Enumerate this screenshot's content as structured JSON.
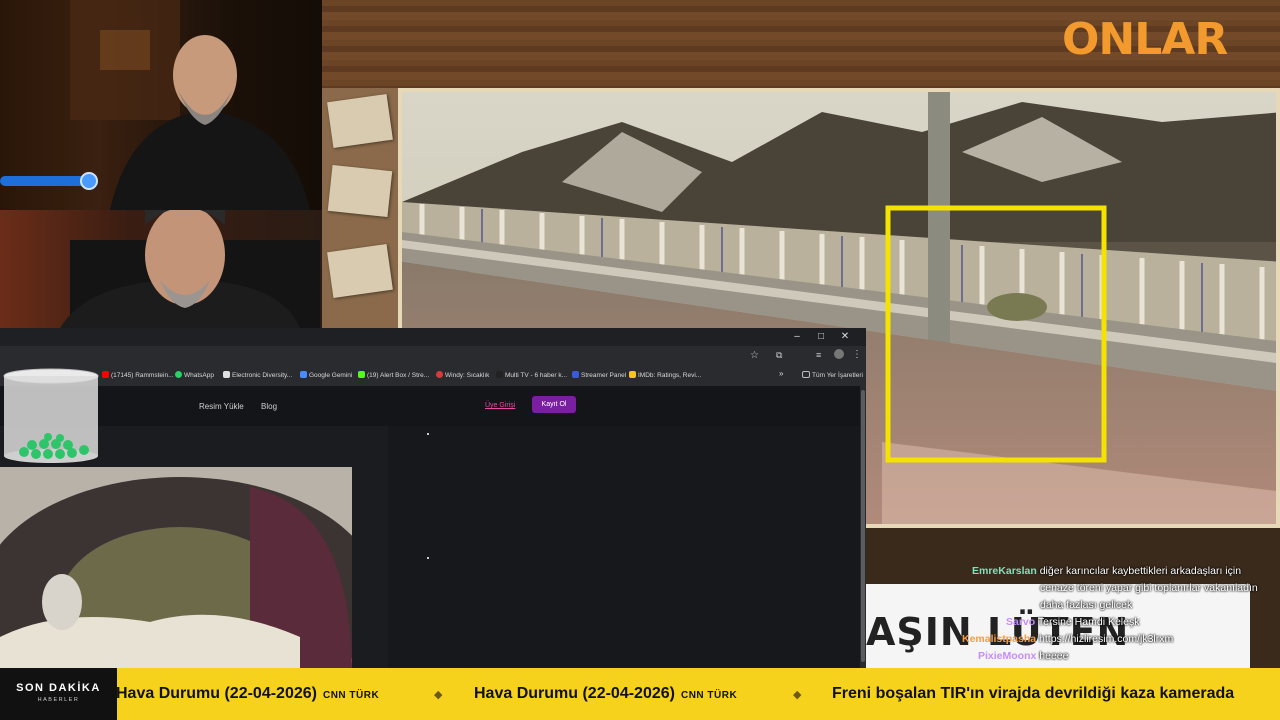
{
  "overlay": {
    "brand_logo": "ONLAR"
  },
  "stream": {
    "highlight_box_color": "#f4e200",
    "slider_color": "#1e6fd9"
  },
  "chat": {
    "banner_text": "AŞIN LÜTEN",
    "messages": [
      {
        "user": "EmreKarslan",
        "text": "diğer karıncılar kaybettikleri arkadaşları için",
        "color": "#7ee2b8"
      },
      {
        "user": "",
        "text": "cenaze töreni yapar gibi toplanırlar vakanıladın",
        "color": "#ffffff"
      },
      {
        "user": "",
        "text": "daha fazlası gelicek",
        "color": "#ffffff"
      },
      {
        "user": "Sarvo",
        "text": "Tersine Hamdi Keleşk",
        "color": "#c58cff"
      },
      {
        "user": "Kemalistpasha",
        "text": "https://hizliresim.com/jk3lrxm",
        "color": "#ff9a3c"
      },
      {
        "user": "PixieMoonx",
        "text": "heeee",
        "color": "#c58cff"
      }
    ]
  },
  "browser": {
    "window_controls": {
      "minimize": "–",
      "maximize": "□",
      "close": "✕"
    },
    "bookmarks": [
      {
        "label": "(17145) Rammstein...",
        "color": "#ff0000"
      },
      {
        "label": "WhatsApp",
        "color": "#25d366"
      },
      {
        "label": "Electronic Diversity...",
        "color": "#e0e0e0"
      },
      {
        "label": "Google Gemini",
        "color": "#4a8cff"
      },
      {
        "label": "(19) Alert Box / Stre...",
        "color": "#53fc18"
      },
      {
        "label": "Windy: Sıcaklık",
        "color": "#d63b3b"
      },
      {
        "label": "Multi TV - 6 haber k...",
        "color": "#222222"
      },
      {
        "label": "Streamer Panel",
        "color": "#3a5bd9"
      },
      {
        "label": "IMDb: Ratings, Revi...",
        "color": "#f5c518"
      }
    ],
    "bookmarks_overflow": "»",
    "all_bookmarks": "Tüm Yer İşaretleri",
    "site_nav": {
      "upload": "Resim Yükle",
      "blog": "Blog",
      "login": "Üye Girişi",
      "register": "Kayıt Ol"
    }
  },
  "ticker": {
    "badge_title": "SON DAKİKA",
    "badge_sub": "HABERLER",
    "items": [
      {
        "headline": "Hava Durumu (22-04-2026)",
        "source": "CNN TÜRK"
      },
      {
        "headline": "Hava Durumu (22-04-2026)",
        "source": "CNN TÜRK"
      },
      {
        "headline": "Freni boşalan TIR'ın virajda devrildiği kaza kamerada",
        "source": ""
      }
    ],
    "separator": "◆"
  }
}
